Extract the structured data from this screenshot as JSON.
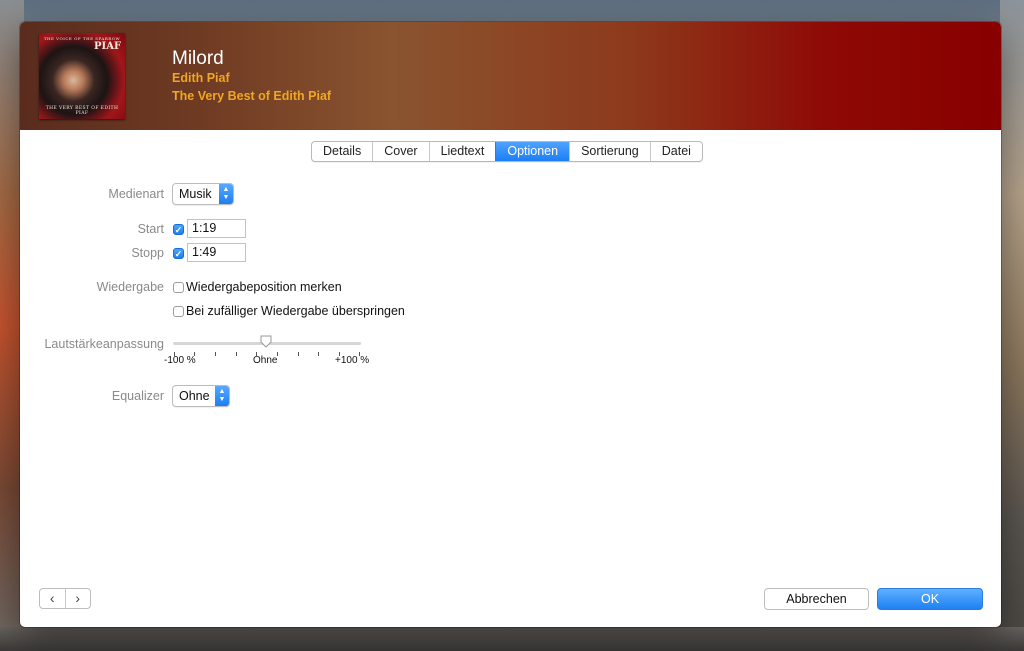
{
  "header": {
    "cover": {
      "top_text": "THE VOICE OF THE SPARROW",
      "name_text": "PIAF",
      "bottom_text": "THE VERY BEST OF EDITH PIAF"
    },
    "title": "Milord",
    "artist": "Edith Piaf",
    "album": "The Very Best of Edith Piaf"
  },
  "tabs": [
    {
      "label": "Details"
    },
    {
      "label": "Cover"
    },
    {
      "label": "Liedtext"
    },
    {
      "label": "Optionen",
      "active": true
    },
    {
      "label": "Sortierung"
    },
    {
      "label": "Datei"
    }
  ],
  "options": {
    "media_kind_label": "Medienart",
    "media_kind_value": "Musik",
    "start_label": "Start",
    "start_checked": true,
    "start_value": "1:19",
    "stop_label": "Stopp",
    "stop_checked": true,
    "stop_value": "1:49",
    "playback_label": "Wiedergabe",
    "remember_position_label": "Wiedergabeposition merken",
    "remember_position_checked": false,
    "skip_shuffle_label": "Bei zufälliger Wiedergabe überspringen",
    "skip_shuffle_checked": false,
    "volume_label": "Lautstärkeanpassung",
    "volume_min_label": "-100 %",
    "volume_mid_label": "Ohne",
    "volume_max_label": "+100 %",
    "volume_value_percent": 0,
    "equalizer_label": "Equalizer",
    "equalizer_value": "Ohne"
  },
  "footer": {
    "prev_glyph": "‹",
    "next_glyph": "›",
    "cancel_label": "Abbrechen",
    "ok_label": "OK"
  },
  "colors": {
    "accent": "#1c7ef5",
    "header_start": "#5a2c1e",
    "header_end": "#880000",
    "artist_text": "#f1a623"
  }
}
